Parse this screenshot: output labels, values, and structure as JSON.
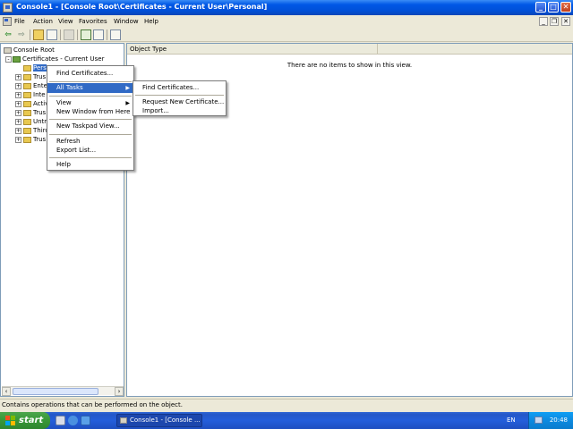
{
  "window": {
    "title": "Console1 - [Console Root\\Certificates - Current User\\Personal]",
    "min_glyph": "_",
    "max_glyph": "□",
    "close_glyph": "✕"
  },
  "menu": {
    "items": [
      "File",
      "Action",
      "View",
      "Favorites",
      "Window",
      "Help"
    ],
    "mdi_min": "_",
    "mdi_restore": "❐",
    "mdi_close": "✕"
  },
  "toolbar": {
    "back_glyph": "⇦",
    "forward_glyph": "⇨"
  },
  "tree": {
    "root": "Console Root",
    "certificates": "Certificates - Current User",
    "children": [
      "Pers",
      "Trus",
      "Ente",
      "Inte",
      "Activ",
      "Trus",
      "Untr",
      "Thirc",
      "Trus"
    ],
    "collapse_glyph": "-",
    "expand_glyph": "+"
  },
  "result": {
    "column": "Object Type",
    "empty": "There are no items to show in this view."
  },
  "context_menu": {
    "items": [
      "Find Certificates...",
      "All Tasks",
      "View",
      "New Window from Here",
      "New Taskpad View...",
      "Refresh",
      "Export List...",
      "Help"
    ],
    "highlighted": "All Tasks"
  },
  "submenu": {
    "items": [
      "Find Certificates...",
      "Request New Certificate...",
      "Import..."
    ]
  },
  "status": {
    "text": "Contains operations that can be performed on the object."
  },
  "taskbar": {
    "start": "start",
    "task": "Console1 - [Console ...",
    "lang": "EN",
    "clock": "20:48"
  },
  "scroll": {
    "left_glyph": "‹",
    "right_glyph": "›"
  },
  "colors": {
    "titlebar": "#0058e6",
    "selection": "#316ac5",
    "taskbar": "#245edb",
    "start_button": "#3a9a3a"
  }
}
